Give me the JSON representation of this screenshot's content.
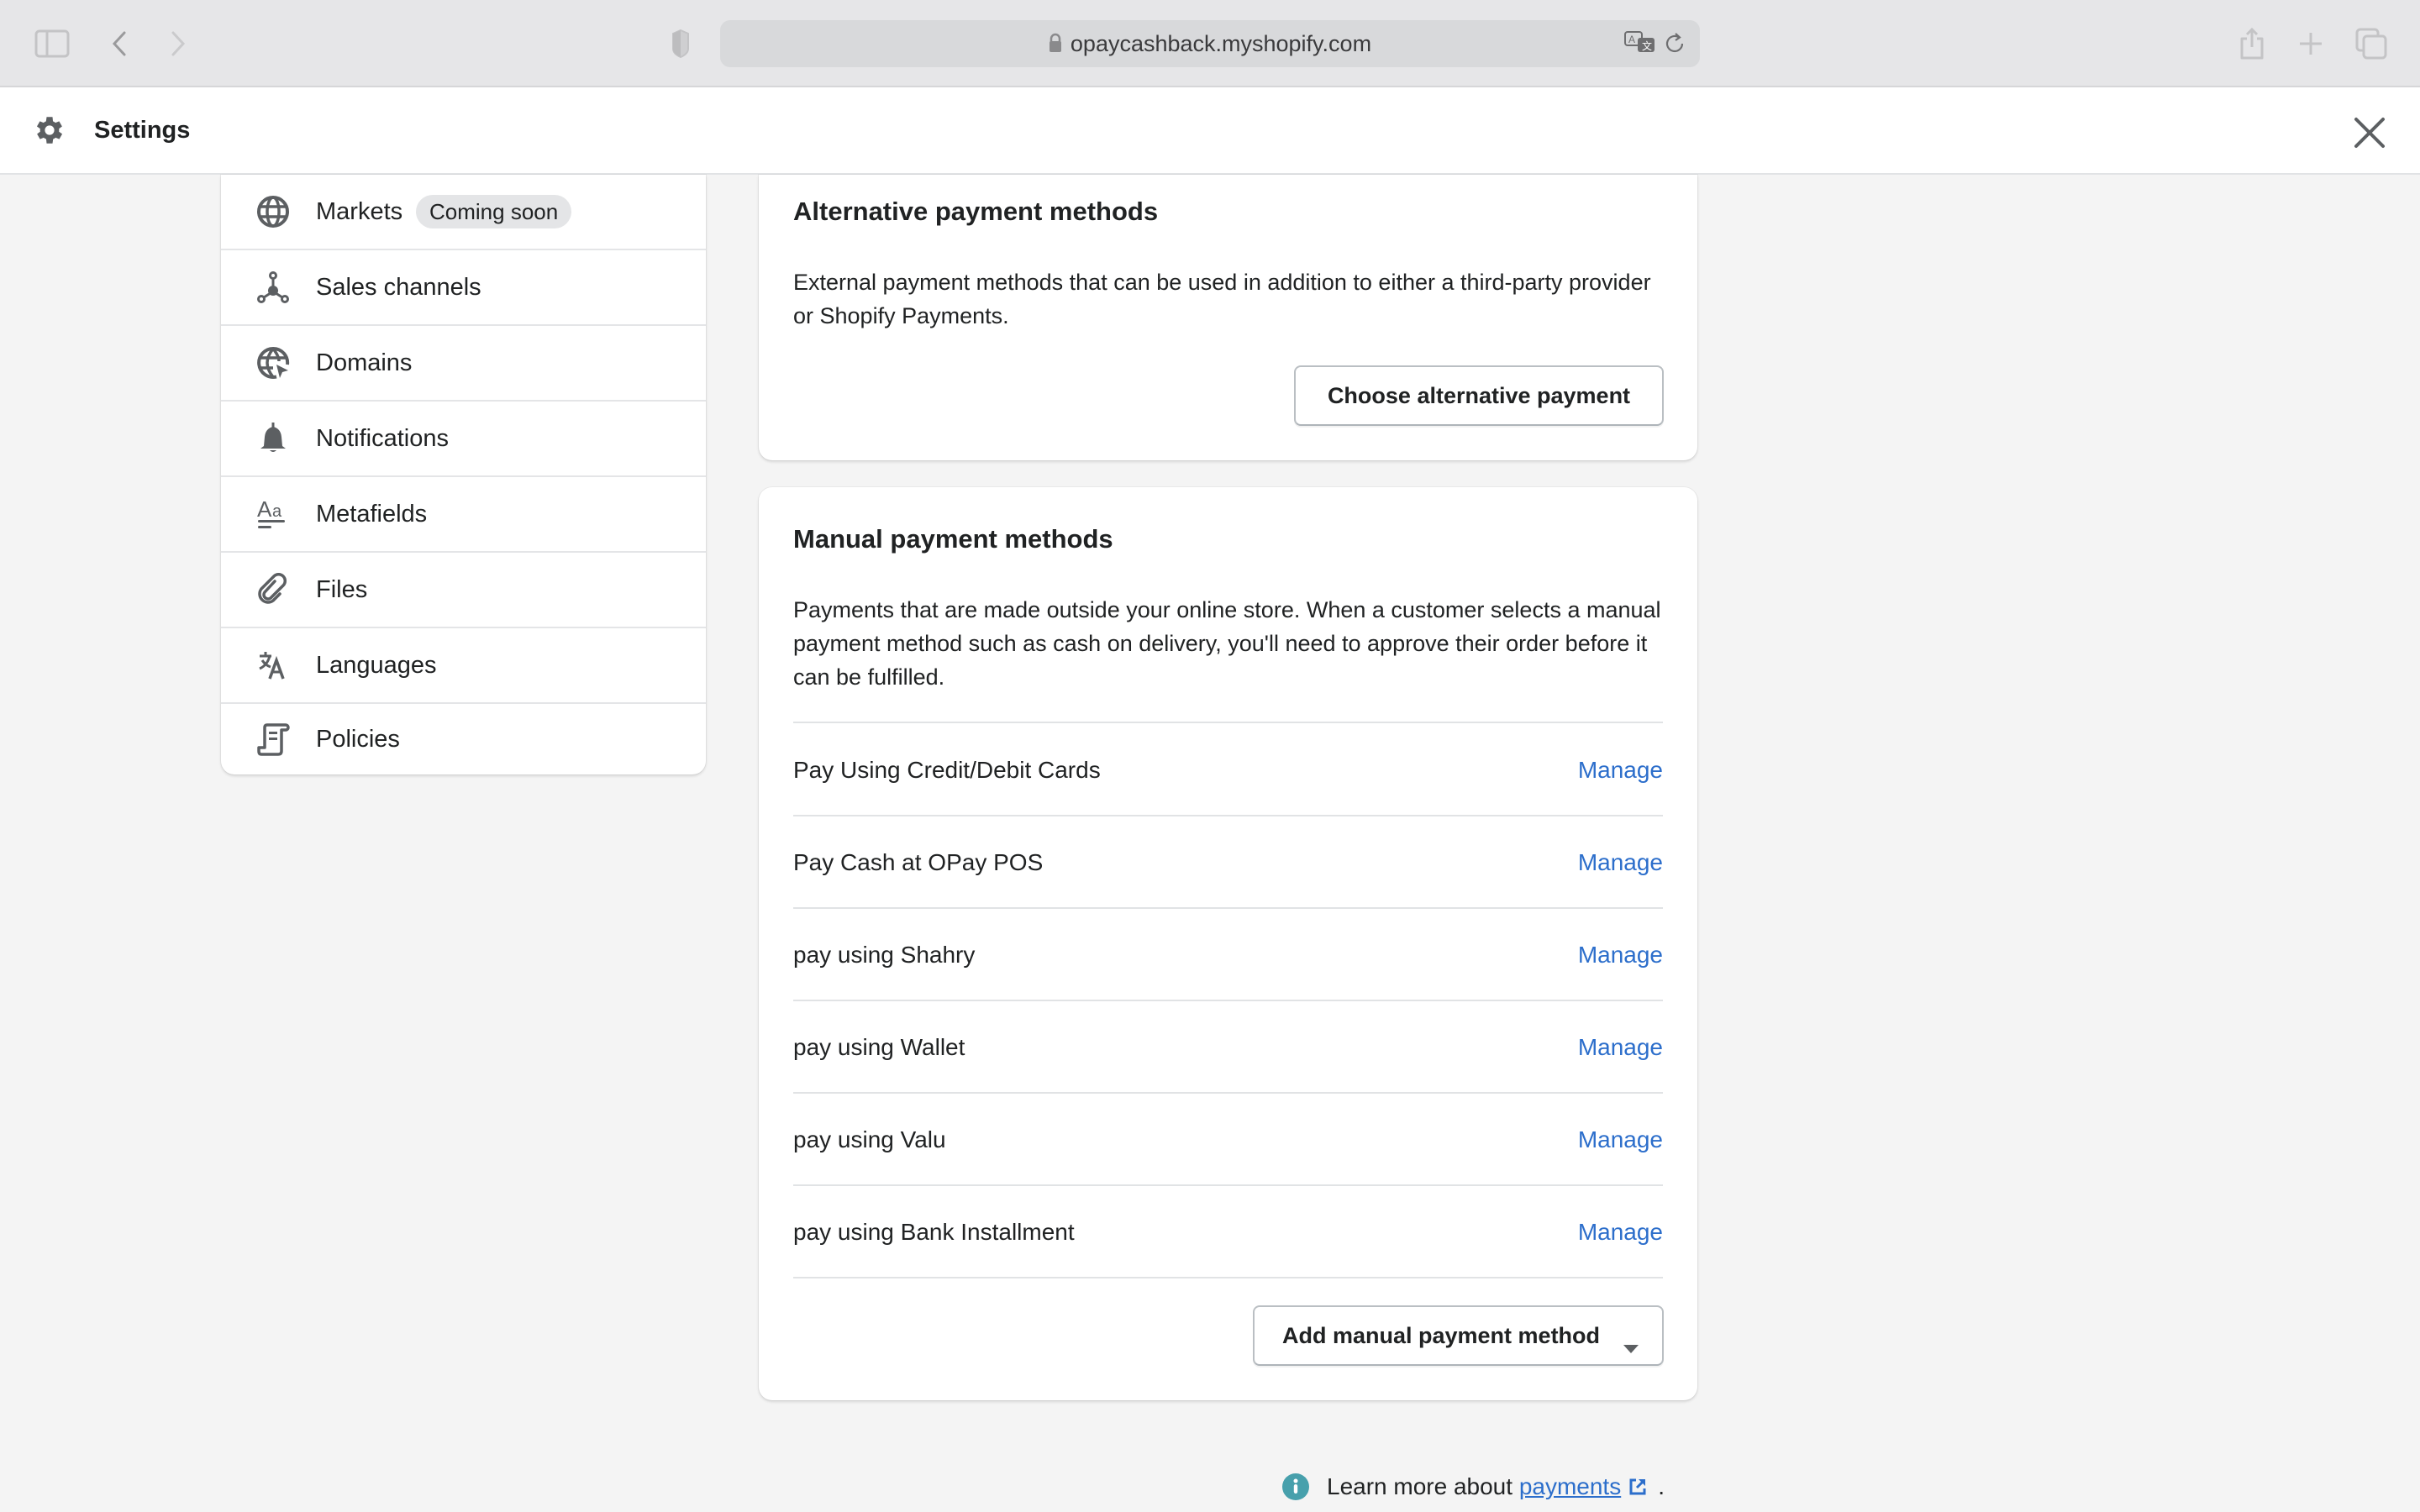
{
  "browser": {
    "url": "opaycashback.myshopify.com",
    "icons": [
      "sidebar-toggle-icon",
      "back-icon",
      "forward-icon",
      "privacy-shield-icon",
      "lock-icon",
      "translate-icon",
      "reload-icon",
      "share-icon",
      "new-tab-icon",
      "tab-overview-icon"
    ]
  },
  "header": {
    "title": "Settings",
    "icon": "gear-icon",
    "close_icon": "close-icon"
  },
  "sidebar": {
    "items": [
      {
        "label": "Markets",
        "icon": "globe-icon",
        "badge": "Coming soon"
      },
      {
        "label": "Sales channels",
        "icon": "sales-channels-icon"
      },
      {
        "label": "Domains",
        "icon": "domains-icon"
      },
      {
        "label": "Notifications",
        "icon": "bell-icon"
      },
      {
        "label": "Metafields",
        "icon": "metafields-icon"
      },
      {
        "label": "Files",
        "icon": "paperclip-icon"
      },
      {
        "label": "Languages",
        "icon": "translate-icon"
      },
      {
        "label": "Policies",
        "icon": "policy-icon"
      }
    ]
  },
  "alternative": {
    "title": "Alternative payment methods",
    "description": "External payment methods that can be used in addition to either a third-party provider or Shopify Payments.",
    "button": "Choose alternative payment"
  },
  "manual": {
    "title": "Manual payment methods",
    "description": "Payments that are made outside your online store. When a customer selects a manual payment method such as cash on delivery, you'll need to approve their order before it can be fulfilled.",
    "methods": [
      {
        "name": "Pay Using Credit/Debit Cards",
        "action": "Manage"
      },
      {
        "name": "Pay Cash at OPay POS",
        "action": "Manage"
      },
      {
        "name": "pay using Shahry",
        "action": "Manage"
      },
      {
        "name": "pay using Wallet",
        "action": "Manage"
      },
      {
        "name": "pay using Valu",
        "action": "Manage"
      },
      {
        "name": "pay using Bank Installment",
        "action": "Manage"
      }
    ],
    "add_button": "Add manual payment method"
  },
  "footer": {
    "text": "Learn more about ",
    "link": "payments",
    "suffix": "."
  },
  "colors": {
    "link": "#2c6ecb",
    "info": "#47a0ac",
    "icon": "#5c5f62"
  }
}
